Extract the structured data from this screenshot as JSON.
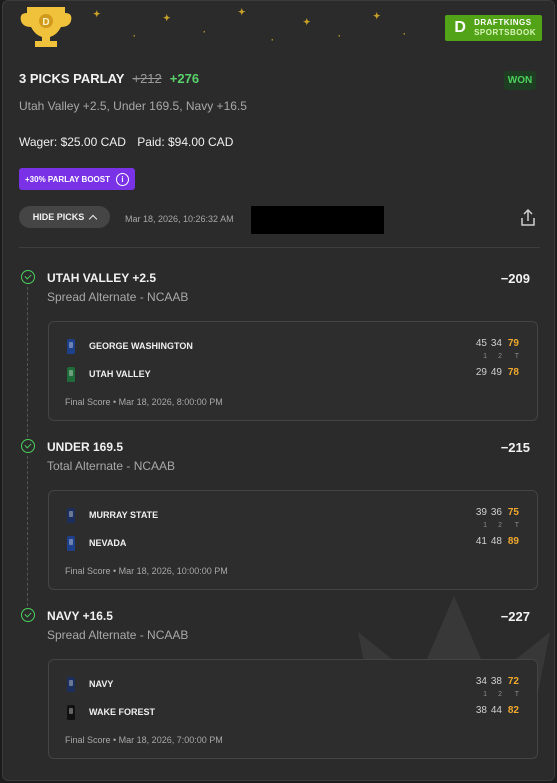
{
  "brand": {
    "line1": "DRAFTKINGS",
    "line2": "SPORTSBOOK",
    "logo_glyph": "D",
    "color": "#53a318"
  },
  "bet": {
    "title": "3 PICKS PARLAY",
    "old_odds": "+212",
    "new_odds": "+276",
    "status": "WON",
    "selections": "Utah Valley +2.5, Under 169.5, Navy +16.5",
    "wager": "Wager: $25.00 CAD",
    "paid": "Paid: $94.00 CAD",
    "boost_label": "+30% PARLAY BOOST",
    "boost_info_glyph": "i",
    "hide_picks_label": "HIDE PICKS",
    "timestamp": "Mar 18, 2026, 10:26:32 AM"
  },
  "colors": {
    "win_green": "#4cd05c",
    "odds_green": "#59d36a",
    "boost_purple": "#7a32e6",
    "total_orange": "#f0a92e"
  },
  "legs": [
    {
      "title": "UTAH VALLEY +2.5",
      "type": "Spread Alternate - NCAAB",
      "odds": "−209",
      "final": "Final Score • Mar 18, 2026, 8:00:00 PM",
      "teams": [
        {
          "name": "GEORGE WASHINGTON",
          "q1": "45",
          "q2": "34",
          "t": "79",
          "jersey": "#1e3f8a"
        },
        {
          "name": "UTAH VALLEY",
          "q1": "29",
          "q2": "49",
          "t": "78",
          "jersey": "#1f6b3a"
        }
      ],
      "headers": {
        "h1": "1",
        "h2": "2",
        "ht": "T"
      }
    },
    {
      "title": "UNDER 169.5",
      "type": "Total Alternate - NCAAB",
      "odds": "−215",
      "final": "Final Score • Mar 18, 2026, 10:00:00 PM",
      "teams": [
        {
          "name": "MURRAY STATE",
          "q1": "39",
          "q2": "36",
          "t": "75",
          "jersey": "#1b2e5c"
        },
        {
          "name": "NEVADA",
          "q1": "41",
          "q2": "48",
          "t": "89",
          "jersey": "#1e3f8a"
        }
      ],
      "headers": {
        "h1": "1",
        "h2": "2",
        "ht": "T"
      }
    },
    {
      "title": "NAVY +16.5",
      "type": "Spread Alternate - NCAAB",
      "odds": "−227",
      "final": "Final Score • Mar 18, 2026, 7:00:00 PM",
      "teams": [
        {
          "name": "NAVY",
          "q1": "34",
          "q2": "38",
          "t": "72",
          "jersey": "#1b2e5c"
        },
        {
          "name": "WAKE FOREST",
          "q1": "38",
          "q2": "44",
          "t": "82",
          "jersey": "#111111"
        }
      ],
      "headers": {
        "h1": "1",
        "h2": "2",
        "ht": "T"
      }
    }
  ]
}
